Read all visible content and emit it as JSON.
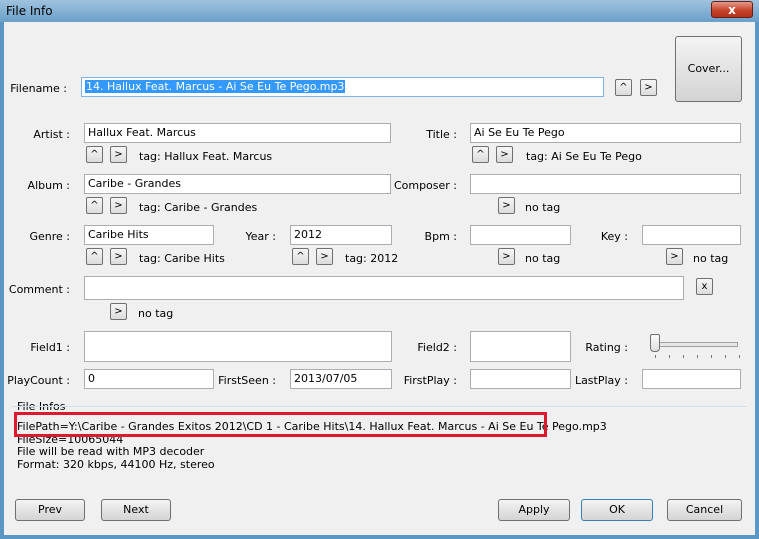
{
  "window": {
    "title": "File Info",
    "close": "x"
  },
  "fields": {
    "filename": {
      "label": "Filename :",
      "value": "14. Hallux Feat. Marcus - Ai Se Eu Te Pego.mp3"
    },
    "artist": {
      "label": "Artist :",
      "value": "Hallux Feat. Marcus",
      "tag": "tag: Hallux Feat. Marcus"
    },
    "title": {
      "label": "Title :",
      "value": "Ai Se Eu Te Pego",
      "tag": "tag: Ai Se Eu Te Pego"
    },
    "album": {
      "label": "Album :",
      "value": "Caribe - Grandes",
      "tag": "tag: Caribe - Grandes"
    },
    "composer": {
      "label": "Composer :",
      "value": "",
      "tag": "no tag"
    },
    "genre": {
      "label": "Genre :",
      "value": "Caribe Hits",
      "tag": "tag: Caribe Hits"
    },
    "year": {
      "label": "Year :",
      "value": "2012",
      "tag": "tag: 2012"
    },
    "bpm": {
      "label": "Bpm :",
      "value": "",
      "tag": "no tag"
    },
    "key": {
      "label": "Key :",
      "value": "",
      "tag": "no tag"
    },
    "comment": {
      "label": "Comment :",
      "value": "",
      "tag": "no tag"
    },
    "field1": {
      "label": "Field1 :",
      "value": ""
    },
    "field2": {
      "label": "Field2 :",
      "value": ""
    },
    "rating": {
      "label": "Rating :",
      "value": 0
    },
    "playcount": {
      "label": "PlayCount :",
      "value": "0"
    },
    "firstseen": {
      "label": "FirstSeen :",
      "value": "2013/07/05"
    },
    "firstplay": {
      "label": "FirstPlay :",
      "value": ""
    },
    "lastplay": {
      "label": "LastPlay :",
      "value": ""
    }
  },
  "glyphs": {
    "up": "^",
    "right": ">",
    "clear": "x"
  },
  "cover_button": "Cover...",
  "file_infos": {
    "heading": "File Infos",
    "lines": [
      "FilePath=Y:\\Caribe - Grandes Exitos 2012\\CD 1 - Caribe Hits\\14. Hallux Feat. Marcus - Ai Se Eu Te Pego.mp3",
      "FileSize=10065044",
      "File will be read with MP3 decoder",
      "Format: 320 kbps, 44100 Hz, stereo"
    ]
  },
  "buttons": {
    "prev": "Prev",
    "next": "Next",
    "apply": "Apply",
    "ok": "OK",
    "cancel": "Cancel"
  },
  "colors": {
    "highlight": "#e0182d",
    "selection": "#3399ff"
  }
}
